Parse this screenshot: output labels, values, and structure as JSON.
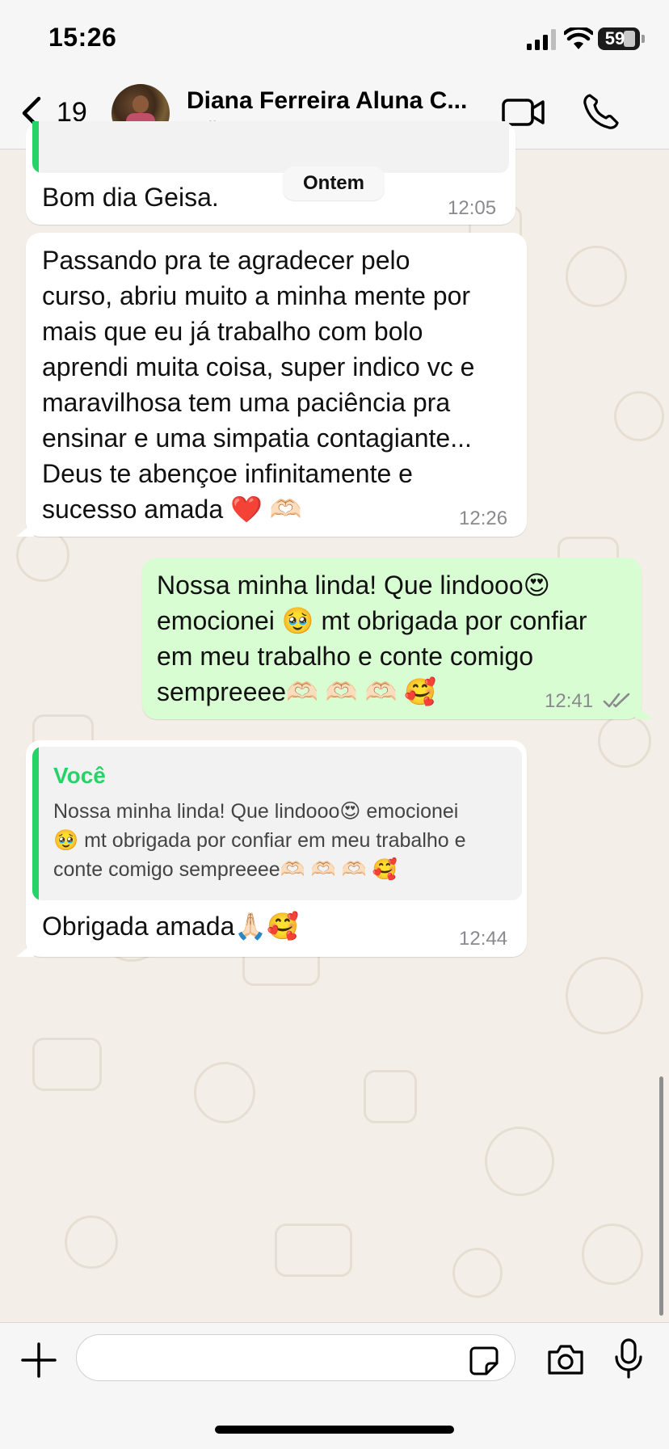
{
  "status_bar": {
    "time": "15:26",
    "battery": "59"
  },
  "header": {
    "back_count": "19",
    "contact_name": "Diana Ferreira Aluna C...",
    "contact_status": "online"
  },
  "date_separator": "Ontem",
  "messages": [
    {
      "direction": "incoming",
      "text": "Bom dia Geisa.",
      "time": "12:05"
    },
    {
      "direction": "incoming",
      "lines": [
        "Passando pra te agradecer pelo",
        "curso, abriu muito a minha mente por",
        "mais que eu já trabalho com bolo",
        "aprendi muita coisa, super indico vc e",
        "maravilhosa tem uma paciência pra",
        "ensinar e uma simpatia contagiante...",
        "Deus te abençoe infinitamente e",
        "sucesso amada ❤️ 🫶🏻"
      ],
      "time": "12:26"
    },
    {
      "direction": "outgoing",
      "lines": [
        "Nossa minha linda! Que lindooo😍",
        "emocionei 🥹 mt obrigada por confiar",
        "em meu trabalho e conte comigo",
        "sempreeee🫶🏻 🫶🏻 🫶🏻 🥰"
      ],
      "time": "12:41",
      "status": "read"
    },
    {
      "direction": "incoming",
      "reply_to": {
        "author": "Você",
        "lines": [
          "Nossa minha linda! Que lindooo😍 emocionei",
          "🥹 mt obrigada por confiar em meu trabalho e",
          "conte comigo sempreeee🫶🏻 🫶🏻 🫶🏻 🥰"
        ]
      },
      "text": "Obrigada amada🙏🏻🥰",
      "time": "12:44"
    }
  ],
  "colors": {
    "accent": "#25d366",
    "outgoing_bubble": "#d9fdd3",
    "incoming_bubble": "#ffffff",
    "chat_background": "#f3efe8"
  }
}
